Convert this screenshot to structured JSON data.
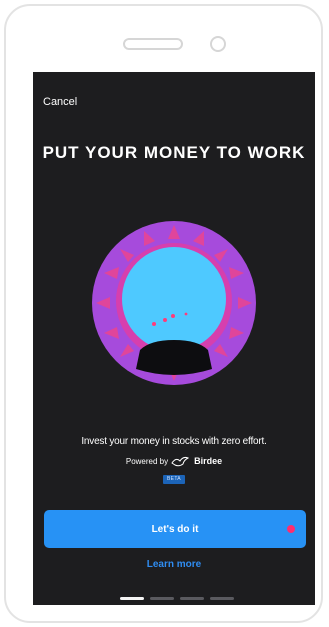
{
  "screen": {
    "cancel_label": "Cancel",
    "title": "Put Your Money to Work",
    "subtitle": "Invest your money in stocks with zero effort.",
    "powered_by": "Powered by",
    "brand_name": "Birdee",
    "beta_badge": "BETA",
    "primary_button": "Let's do it",
    "secondary_link": "Learn more",
    "pagination": {
      "total": 4,
      "active_index": 0
    }
  },
  "colors": {
    "background": "#1d1d1f",
    "primary": "#2792f5",
    "link": "#2f8cf0",
    "orb": "#4ec9ff",
    "aura": "#a64bdc",
    "accent": "#ff2d6f"
  },
  "icons": {
    "illustration": "crystal-ball-illustration",
    "brand_logo": "birdee-bird-logo",
    "record_indicator": "red-dot"
  }
}
